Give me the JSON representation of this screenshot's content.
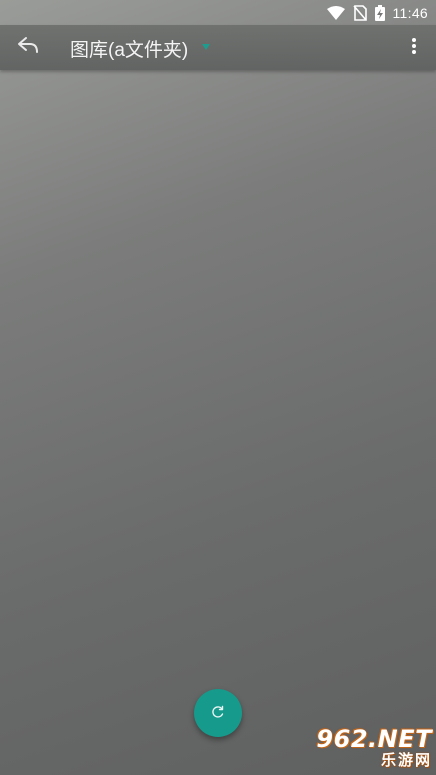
{
  "status_bar": {
    "time": "11:46",
    "icons": [
      "wifi-icon",
      "no-sim-icon",
      "battery-charging-icon"
    ]
  },
  "app_bar": {
    "back_icon": "reply-back-icon",
    "title": "图库(a文件夹)",
    "dropdown_icon": "triangle-down-icon",
    "overflow_icon": "more-vert-icon"
  },
  "fab": {
    "icon": "refresh-icon",
    "color": "#169a8b"
  },
  "watermark": {
    "brand": "962.NET",
    "subtitle": "乐游网"
  },
  "colors": {
    "accent": "#169a8b",
    "background": "#6f7070"
  }
}
